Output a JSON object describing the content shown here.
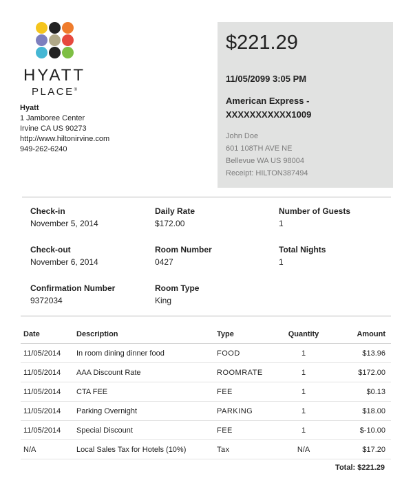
{
  "logo": {
    "word_top": "HYATT",
    "word_bottom": "PLACE",
    "registered_mark": "®",
    "dot_colors": [
      "#f5c51d",
      "#222222",
      "#ef7c2c",
      "#7d7fbe",
      "#b0a888",
      "#e6493e",
      "#45b7d4",
      "#222222",
      "#7ebf44"
    ]
  },
  "hotel": {
    "name": "Hyatt",
    "street": "1 Jamboree Center",
    "city": "Irvine CA US 90273",
    "website": "http://www.hiltonirvine.com",
    "phone": "949-262-6240"
  },
  "payment": {
    "amount": "$221.29",
    "datetime": "11/05/2099 3:05 PM",
    "card_line1": "American Express -",
    "card_line2": "XXXXXXXXXXX1009",
    "customer_name": "John Doe",
    "customer_street": "601 108TH AVE NE",
    "customer_city": "Bellevue WA US 98004",
    "receipt": "Receipt: HILTON387494"
  },
  "stay": {
    "checkin_label": "Check-in",
    "checkin_value": "November 5, 2014",
    "daily_rate_label": "Daily Rate",
    "daily_rate_value": "$172.00",
    "guests_label": "Number of Guests",
    "guests_value": "1",
    "checkout_label": "Check-out",
    "checkout_value": "November 6, 2014",
    "room_number_label": "Room Number",
    "room_number_value": "0427",
    "nights_label": "Total Nights",
    "nights_value": "1",
    "confirmation_label": "Confirmation Number",
    "confirmation_value": "9372034",
    "room_type_label": "Room Type",
    "room_type_value": "King"
  },
  "items": {
    "headers": {
      "date": "Date",
      "description": "Description",
      "type": "Type",
      "quantity": "Quantity",
      "amount": "Amount"
    },
    "rows": [
      {
        "date": "11/05/2014",
        "description": "In room dining dinner food",
        "type": "FOOD",
        "quantity": "1",
        "amount": "$13.96"
      },
      {
        "date": "11/05/2014",
        "description": "AAA Discount Rate",
        "type": "ROOMRATE",
        "quantity": "1",
        "amount": "$172.00"
      },
      {
        "date": "11/05/2014",
        "description": "CTA FEE",
        "type": "FEE",
        "quantity": "1",
        "amount": "$0.13"
      },
      {
        "date": "11/05/2014",
        "description": "Parking Overnight",
        "type": "PARKING",
        "quantity": "1",
        "amount": "$18.00"
      },
      {
        "date": "11/05/2014",
        "description": "Special Discount",
        "type": "FEE",
        "quantity": "1",
        "amount": "$-10.00"
      },
      {
        "date": "N/A",
        "description": "Local Sales Tax for Hotels (10%)",
        "type": "Tax",
        "quantity": "N/A",
        "amount": "$17.20"
      }
    ],
    "total": "Total: $221.29"
  }
}
